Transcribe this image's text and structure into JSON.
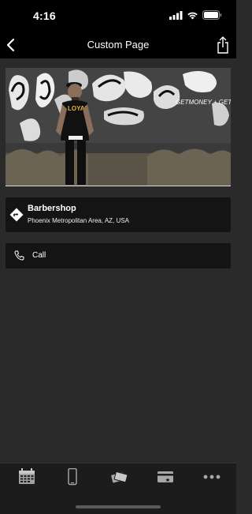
{
  "status_bar": {
    "time": "4:16"
  },
  "nav": {
    "title": "Custom Page"
  },
  "hero": {
    "graffiti_text": "GETMONEY + GETPAID",
    "shirt_text": "LOYAL"
  },
  "location": {
    "title": "Barbershop",
    "subtitle": "Phoenix Metropolitan Area, AZ, USA"
  },
  "call": {
    "label": "Call"
  },
  "tabs": [
    "calendar-icon",
    "mobile-icon",
    "tickets-icon",
    "card-icon",
    "more-icon"
  ]
}
